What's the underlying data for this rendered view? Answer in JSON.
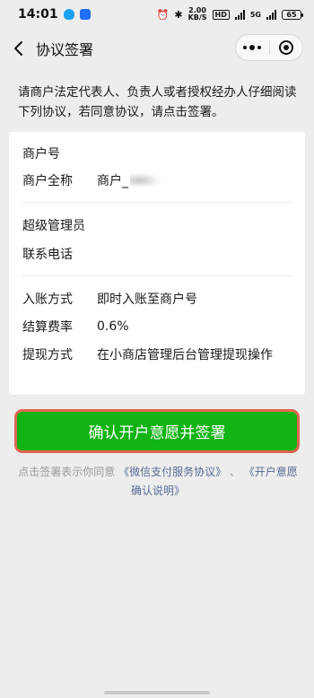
{
  "status_bar": {
    "time": "14:01",
    "speed_value": "2.00",
    "speed_unit": "KB/S",
    "hd_label": "HD",
    "signal_label": "5G",
    "battery": "65"
  },
  "nav": {
    "title": "协议签署"
  },
  "intro_text": "请商户法定代表人、负责人或者授权经办人仔细阅读下列协议，若同意协议，请点击签署。",
  "merchant": {
    "merchant_no_label": "商户号",
    "merchant_no_value": "",
    "full_name_label": "商户全称",
    "full_name_value": "商户_"
  },
  "admin": {
    "super_admin_label": "超级管理员",
    "super_admin_value": "",
    "phone_label": "联系电话",
    "phone_value": ""
  },
  "settlement": {
    "entry_label": "入账方式",
    "entry_value": "即时入账至商户号",
    "fee_label": "结算费率",
    "fee_value": "0.6%",
    "withdraw_label": "提现方式",
    "withdraw_value": "在小商店管理后台管理提现操作"
  },
  "confirm_button": "确认开户意愿并签署",
  "footnote": {
    "prefix": "点击签署表示你同意 ",
    "link1": "《微信支付服务协议》",
    "separator": " 、 ",
    "link2": "《开户意愿确认说明》"
  },
  "colors": {
    "primary_green": "#12b314",
    "link_blue": "#576b95",
    "page_bg": "#ededed"
  }
}
